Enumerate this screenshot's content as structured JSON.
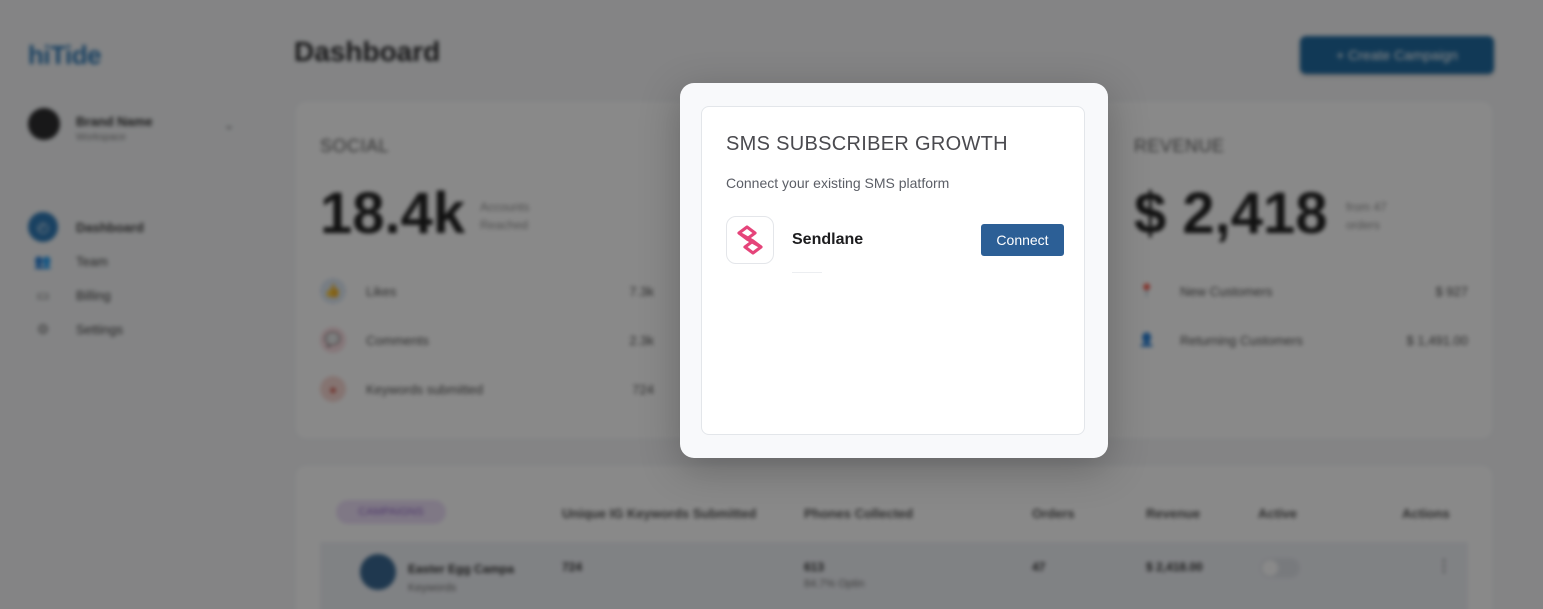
{
  "sidebar": {
    "logo": "hiTide",
    "brand_name": "Brand Name",
    "brand_sub": "Workspace",
    "items": [
      {
        "label": "Dashboard"
      },
      {
        "label": "Team"
      },
      {
        "label": "Billing"
      },
      {
        "label": "Settings"
      }
    ]
  },
  "header": {
    "title": "Dashboard",
    "create_button": "+ Create Campaign"
  },
  "stats": {
    "social": {
      "title": "SOCIAL",
      "value": "18.4k",
      "value_sub": "Accounts Reached",
      "rows": [
        {
          "label": "Likes",
          "value": "7.3k"
        },
        {
          "label": "Comments",
          "value": "2.3k"
        },
        {
          "label": "Keywords submitted",
          "value": "724"
        }
      ]
    },
    "revenue": {
      "title": "REVENUE",
      "value": "$ 2,418",
      "value_sub": "from 47 orders",
      "rows": [
        {
          "label": "New Customers",
          "value": "$ 927"
        },
        {
          "label": "Returning Customers",
          "value": "$ 1,491.00"
        }
      ]
    }
  },
  "table": {
    "pill": "CAMPAIGNS",
    "headers": [
      "Unique IG Keywords Submitted",
      "Phones Collected",
      "Orders",
      "Revenue",
      "Active",
      "Actions"
    ],
    "row": {
      "name": "Easter Egg Campa",
      "sub": "Keywords",
      "keywords": "724",
      "phones": "613",
      "phones_sub": "84.7% Optin",
      "orders": "47",
      "revenue": "$ 2,418.00"
    }
  },
  "modal": {
    "title": "SMS SUBSCRIBER GROWTH",
    "subtitle": "Connect your existing SMS platform",
    "integration_name": "Sendlane",
    "connect_label": "Connect"
  },
  "colors": {
    "connect_button": "#2c5f96",
    "sendlane_logo": "#e5447a",
    "overlay": "rgba(20,20,20,0.5)"
  }
}
